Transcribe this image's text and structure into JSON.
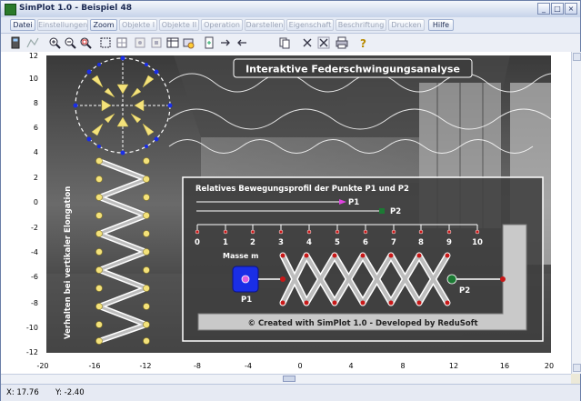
{
  "window": {
    "title": "SimPlot 1.0 - Beispiel 48",
    "buttons": {
      "minimize": "_",
      "maximize": "□",
      "close": "×"
    }
  },
  "menu": {
    "items": [
      {
        "label": "Datei",
        "enabled": true
      },
      {
        "label": "Einstellungen",
        "enabled": false
      },
      {
        "label": "Zoom",
        "enabled": true
      },
      {
        "label": "Objekte I",
        "enabled": false
      },
      {
        "label": "Objekte II",
        "enabled": false
      },
      {
        "label": "Operation",
        "enabled": false
      },
      {
        "label": "Darstellen",
        "enabled": false
      },
      {
        "label": "Eigenschaft",
        "enabled": false
      },
      {
        "label": "Beschriftung",
        "enabled": false
      },
      {
        "label": "Drucken",
        "enabled": false
      },
      {
        "label": "Hilfe",
        "enabled": true
      }
    ]
  },
  "toolbar": {
    "icons": [
      "calculator-icon",
      "function-icon",
      "zoom-in-icon",
      "zoom-out-icon",
      "zoom-fit-icon",
      "select-rect-icon",
      "grid-icon",
      "axes-icon",
      "copy-image-icon",
      "table-icon",
      "move-icon",
      "arrow-right-icon",
      "arrow-left-icon",
      "page-icon",
      "cross-icon",
      "delete-icon",
      "print-icon",
      "help-icon"
    ]
  },
  "plot": {
    "x_ticks": [
      "-20",
      "-16",
      "-12",
      "-8",
      "-4",
      "0",
      "4",
      "8",
      "12",
      "16",
      "20"
    ],
    "y_ticks": [
      "12",
      "10",
      "8",
      "6",
      "4",
      "2",
      "0",
      "-2",
      "-4",
      "-6",
      "-8",
      "-10",
      "-12"
    ],
    "banner": "Interaktive Federschwingungsanalyse",
    "side_label": "Verhalten bei vertikaler Elongation",
    "inset": {
      "title": "Relatives Bewegungsprofil der Punkte P1 und P2",
      "p1_label": "P1",
      "p2_label": "P2",
      "scale_numbers": [
        "0",
        "1",
        "2",
        "3",
        "4",
        "5",
        "6",
        "7",
        "8",
        "9",
        "10"
      ],
      "mass_label": "Masse m",
      "mass_point_label": "P1",
      "spring_point_label": "P2",
      "credit": "© Created with SimPlot 1.0 - Developed by ReduSoft"
    },
    "colors": {
      "mass": "#1a2ee6",
      "point_red": "#c81818",
      "point_green": "#1c7a34",
      "arrow_yellow": "#f4e27a"
    }
  },
  "status": {
    "x_label": "X: 17.76",
    "y_label": "Y: -2.40"
  }
}
